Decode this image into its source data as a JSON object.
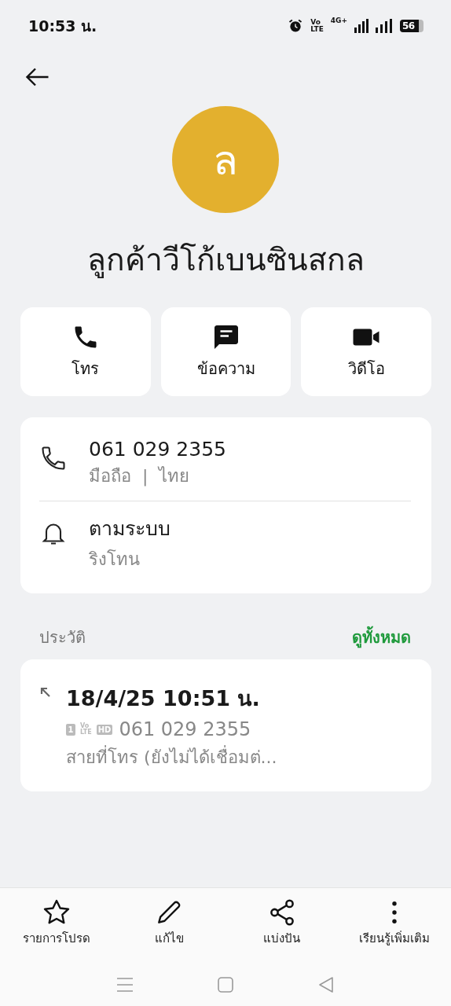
{
  "status_bar": {
    "time": "10:53 น.",
    "volte_top": "Vo",
    "volte_bottom": "LTE",
    "network": "4G+",
    "battery": "56"
  },
  "contact": {
    "initial": "ล",
    "name": "ลูกค้าวีโก้เบนซินสกล"
  },
  "actions": [
    {
      "kind": "call",
      "label": "โทร"
    },
    {
      "kind": "message",
      "label": "ข้อความ"
    },
    {
      "kind": "video",
      "label": "วิดีโอ"
    }
  ],
  "details": [
    {
      "kind": "phone",
      "title": "061 029 2355",
      "subtitle": "มือถือ  |  ไทย"
    },
    {
      "kind": "ringtone",
      "title": "ตามระบบ",
      "subtitle": "ริงโทน"
    }
  ],
  "history": {
    "label": "ประวัติ",
    "view_all": "ดูทั้งหมด",
    "items": [
      {
        "kind": "outgoing",
        "time": "18/4/25 10:51 น.",
        "sim": "1",
        "volte_top": "Vo",
        "volte_bottom": "LTE",
        "hd": "HD",
        "number": "061 029 2355",
        "status": "สายที่โทร (ยังไม่ได้เชื่อมต่..."
      }
    ]
  },
  "bottom_actions": [
    {
      "kind": "star",
      "label": "รายการโปรด"
    },
    {
      "kind": "edit",
      "label": "แก้ไข"
    },
    {
      "kind": "share",
      "label": "แบ่งปัน"
    },
    {
      "kind": "more",
      "label": "เรียนรู้เพิ่มเติม"
    }
  ]
}
